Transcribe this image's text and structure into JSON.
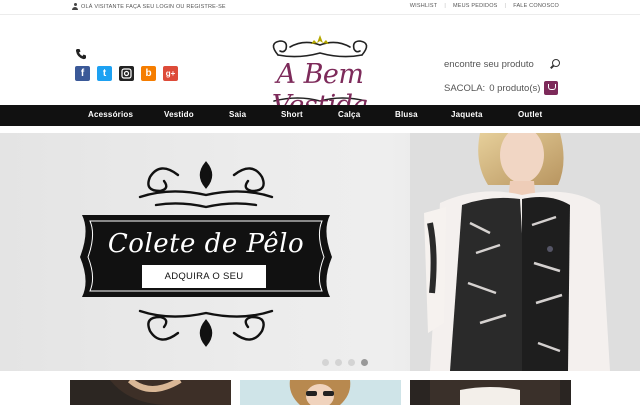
{
  "topbar": {
    "greeting": "OLÁ VISITANTE FAÇA SEU LOGIN OU REGISTRE-SE",
    "links": [
      "WISHLIST",
      "MEUS PEDIDOS",
      "FALE CONOSCO"
    ]
  },
  "header": {
    "logo_text": "A Bem Vestida",
    "search_placeholder": "encontre seu produto",
    "cart_label": "SACOLA:",
    "cart_count_text": "0 produto(s)"
  },
  "social": [
    "f",
    "t",
    "ig",
    "b",
    "g+"
  ],
  "nav": [
    "Acessórios",
    "Vestido",
    "Saia",
    "Short",
    "Calça",
    "Blusa",
    "Jaqueta",
    "Outlet"
  ],
  "hero": {
    "title": "Colete de Pêlo",
    "button_label": "ADQUIRA O SEU",
    "slides": 4,
    "active_slide": 4
  },
  "colors": {
    "brand": "#7d2a5a",
    "nav_bg": "#111111",
    "facebook": "#3b5998",
    "twitter": "#1da1f2",
    "instagram": "#222222",
    "blogger": "#f57d00",
    "googleplus": "#dd4b39"
  }
}
